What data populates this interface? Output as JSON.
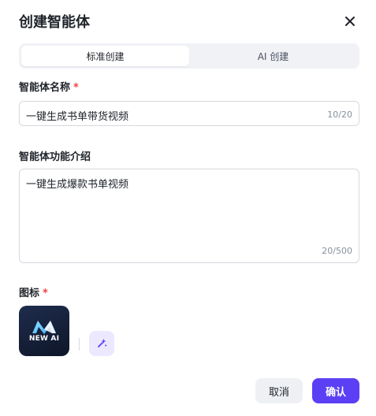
{
  "dialog": {
    "title": "创建智能体",
    "close_icon": "close-icon"
  },
  "tabs": [
    {
      "label": "标准创建",
      "active": true
    },
    {
      "label": "AI 创建",
      "active": false
    }
  ],
  "name_field": {
    "label": "智能体名称",
    "required_mark": "*",
    "value": "一键生成书单带货视频",
    "counter": "10/20"
  },
  "desc_field": {
    "label": "智能体功能介绍",
    "value": "一键生成爆款书单视频",
    "counter": "20/500"
  },
  "icon_field": {
    "label": "图标",
    "required_mark": "*",
    "logo_text": "NEW AI",
    "ai_generate_icon": "sparkle-icon"
  },
  "footer": {
    "cancel_label": "取消",
    "confirm_label": "确认"
  },
  "colors": {
    "accent": "#5b3ff5",
    "required": "#f53f3f",
    "ai_button_bg": "#ece8ff"
  }
}
